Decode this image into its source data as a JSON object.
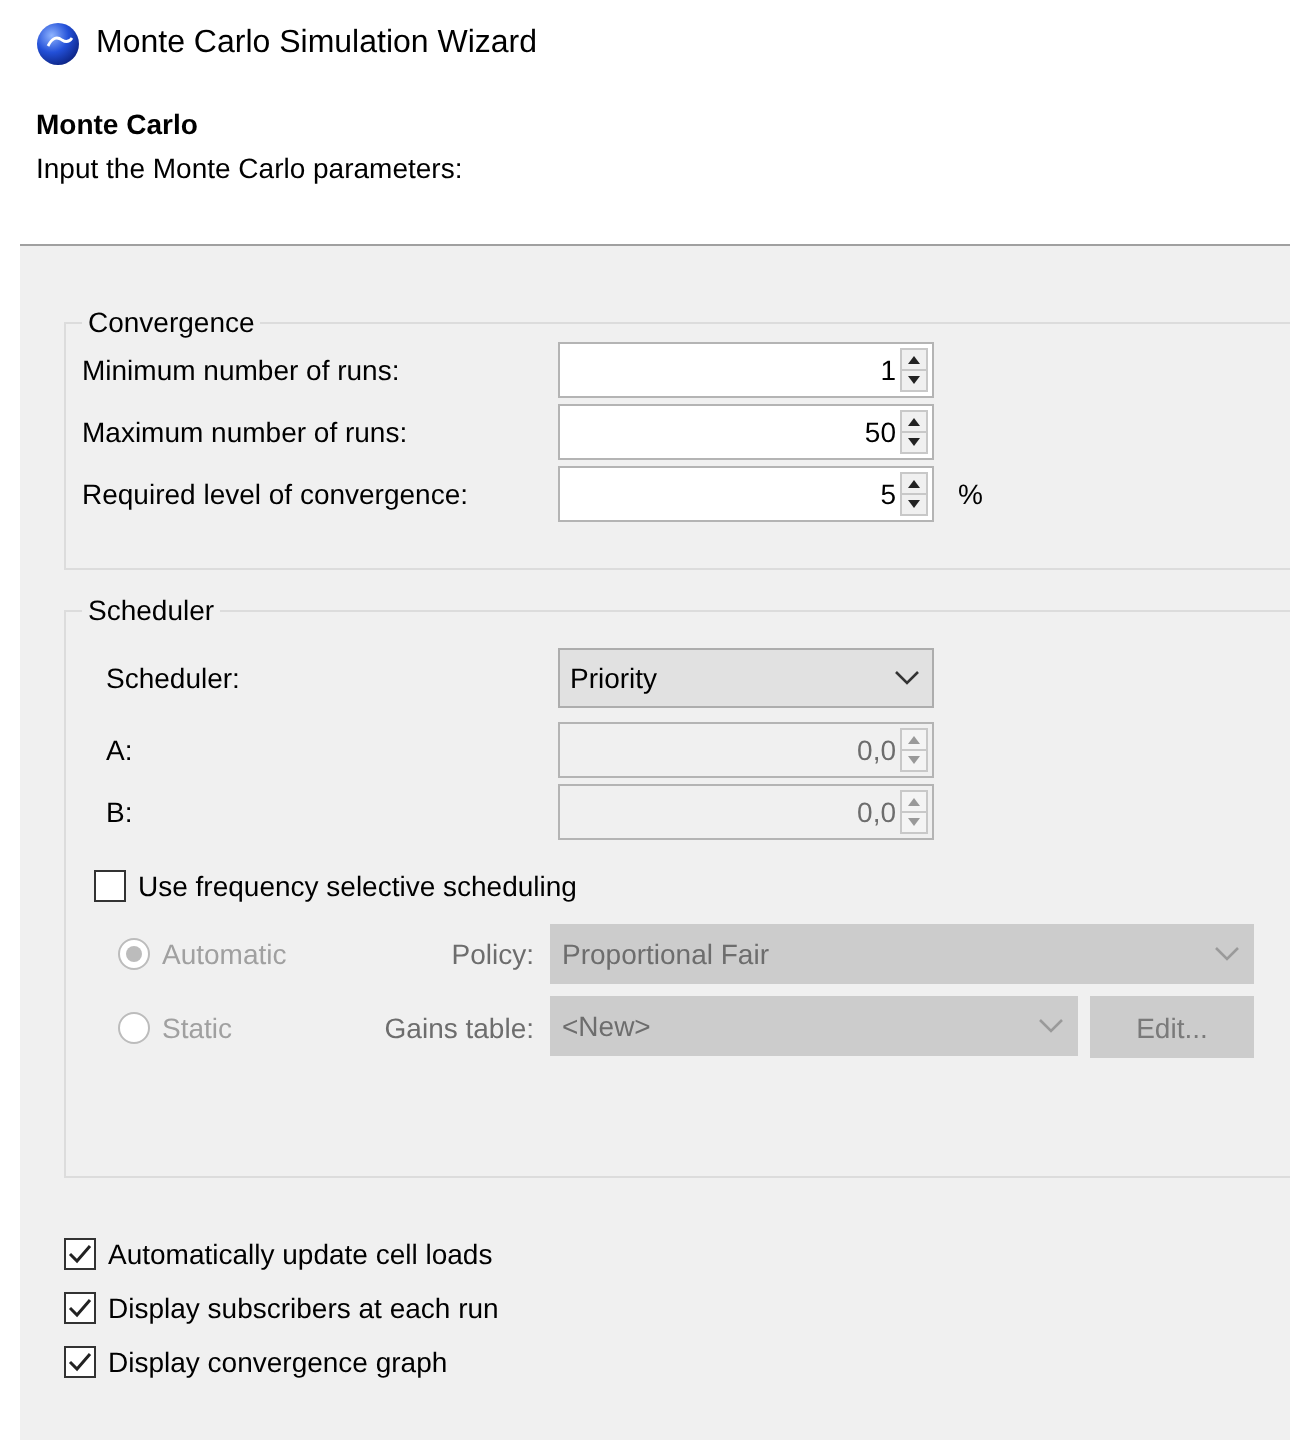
{
  "window": {
    "title": "Monte Carlo Simulation Wizard"
  },
  "header": {
    "title": "Monte Carlo",
    "subtitle": "Input the Monte Carlo parameters:"
  },
  "convergence": {
    "legend": "Convergence",
    "fields": [
      {
        "label": "Minimum number of runs:",
        "value": "1",
        "disabled": false
      },
      {
        "label": "Maximum number of runs:",
        "value": "50",
        "disabled": false
      },
      {
        "label": "Required level of convergence:",
        "value": "5",
        "disabled": false,
        "unit": "%"
      }
    ]
  },
  "scheduler": {
    "legend": "Scheduler",
    "scheduler_field": {
      "label": "Scheduler:",
      "value": "Priority",
      "disabled": false
    },
    "fields": [
      {
        "label": "A:",
        "value": "0,0",
        "disabled": true
      },
      {
        "label": "B:",
        "value": "0,0",
        "disabled": true
      }
    ],
    "frequency_selective": {
      "label": "Use frequency selective scheduling",
      "checked": false
    },
    "modes": [
      {
        "label": "Automatic",
        "selected": true,
        "disabled": true
      },
      {
        "label": "Static",
        "selected": false,
        "disabled": true
      }
    ],
    "policy": {
      "label": "Policy:",
      "value": "Proportional Fair",
      "disabled": true
    },
    "gains_table": {
      "label": "Gains table:",
      "value": "<New>",
      "disabled": true
    },
    "edit_button": {
      "label": "Edit...",
      "disabled": true
    }
  },
  "options": [
    {
      "label": "Automatically update cell loads",
      "checked": true
    },
    {
      "label": "Display subscribers at each run",
      "checked": true
    },
    {
      "label": "Display convergence graph",
      "checked": true
    }
  ]
}
